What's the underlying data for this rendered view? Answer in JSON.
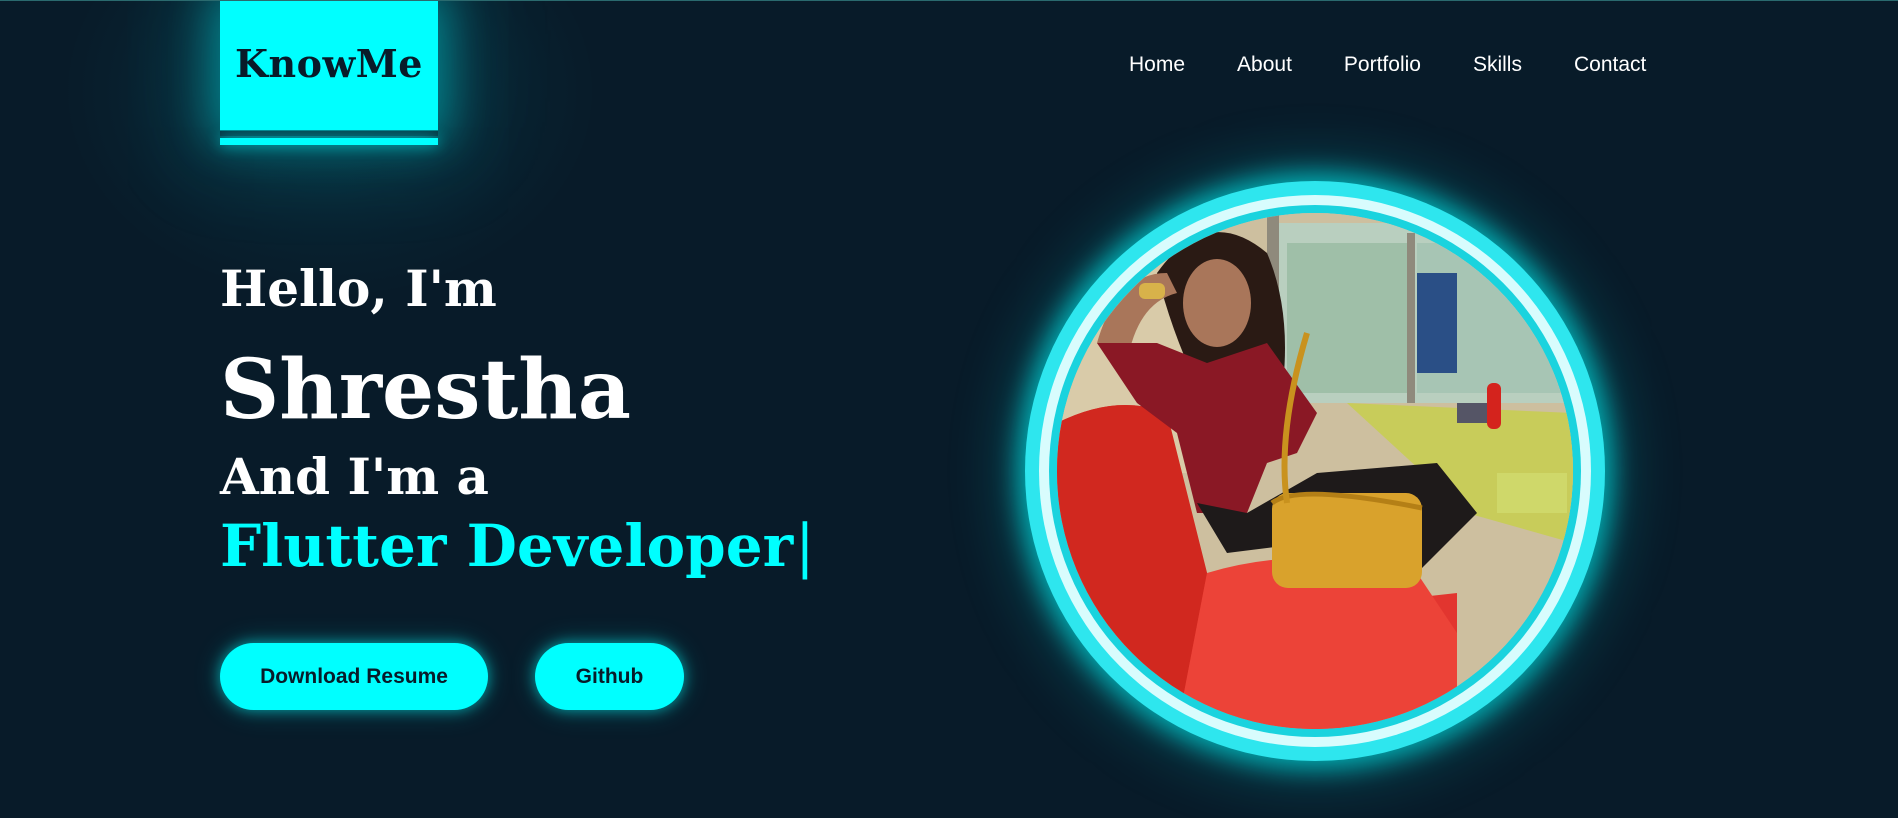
{
  "logo": {
    "text": "KnowMe"
  },
  "nav": {
    "items": [
      {
        "label": "Home"
      },
      {
        "label": "About"
      },
      {
        "label": "Portfolio"
      },
      {
        "label": "Skills"
      },
      {
        "label": "Contact"
      }
    ]
  },
  "hero": {
    "greeting": "Hello, I'm",
    "name": "Shrestha",
    "and_line": "And I'm a",
    "role": "Flutter Developer",
    "cursor": "|"
  },
  "buttons": {
    "resume": "Download Resume",
    "github": "Github"
  },
  "colors": {
    "background": "#081b29",
    "accent": "#00ffff",
    "text": "#ffffff"
  },
  "icons": {
    "profile_photo": "profile-photo"
  }
}
